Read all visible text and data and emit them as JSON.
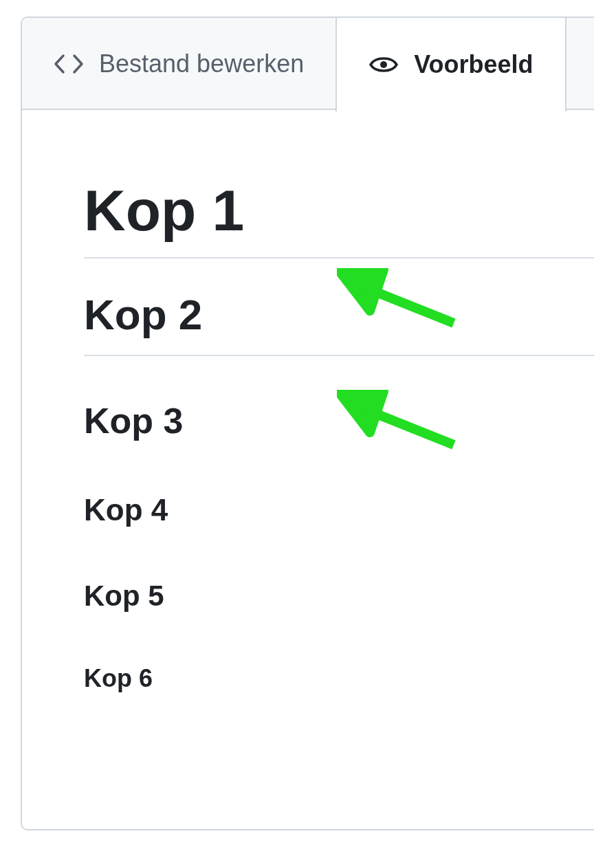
{
  "tabs": [
    {
      "label": "Bestand bewerken",
      "kind": "code",
      "selected": false
    },
    {
      "label": "Voorbeeld",
      "kind": "eye",
      "selected": true
    }
  ],
  "headings": [
    {
      "kind": "h1",
      "text": "Kop 1"
    },
    {
      "kind": "h2",
      "text": "Kop 2"
    },
    {
      "kind": "h3",
      "text": "Kop 3"
    },
    {
      "kind": "h4",
      "text": "Kop 4"
    },
    {
      "kind": "h5",
      "text": "Kop 5"
    },
    {
      "kind": "h6",
      "text": "Kop 6"
    }
  ]
}
